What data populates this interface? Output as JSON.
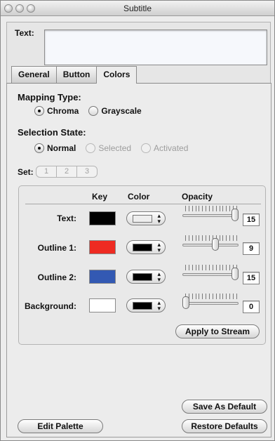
{
  "window": {
    "title": "Subtitle"
  },
  "text_field": {
    "label": "Text:",
    "value": ""
  },
  "tabs": [
    {
      "label": "General",
      "active": false
    },
    {
      "label": "Button",
      "active": false
    },
    {
      "label": "Colors",
      "active": true
    }
  ],
  "mapping": {
    "label": "Mapping Type:",
    "options": [
      {
        "label": "Chroma",
        "selected": true
      },
      {
        "label": "Grayscale",
        "selected": false
      }
    ]
  },
  "selection": {
    "label": "Selection State:",
    "options": [
      {
        "label": "Normal",
        "selected": true,
        "enabled": true
      },
      {
        "label": "Selected",
        "selected": false,
        "enabled": false
      },
      {
        "label": "Activated",
        "selected": false,
        "enabled": false
      }
    ]
  },
  "set": {
    "label": "Set:",
    "options": [
      "1",
      "2",
      "3"
    ]
  },
  "color_table": {
    "headers": {
      "key": "Key",
      "color": "Color",
      "opacity": "Opacity"
    },
    "rows": [
      {
        "label": "Text:",
        "key_color": "#000000",
        "color_chip": "#eeeeee",
        "opacity": 15,
        "max": 15
      },
      {
        "label": "Outline 1:",
        "key_color": "#ee2b22",
        "color_chip": "#000000",
        "opacity": 9,
        "max": 15
      },
      {
        "label": "Outline 2:",
        "key_color": "#3359b3",
        "color_chip": "#000000",
        "opacity": 15,
        "max": 15
      },
      {
        "label": "Background:",
        "key_color": "#ffffff",
        "color_chip": "#000000",
        "opacity": 0,
        "max": 15
      }
    ]
  },
  "buttons": {
    "apply_to_stream": "Apply to Stream",
    "save_as_default": "Save As Default",
    "edit_palette": "Edit Palette",
    "restore_defaults": "Restore Defaults"
  }
}
